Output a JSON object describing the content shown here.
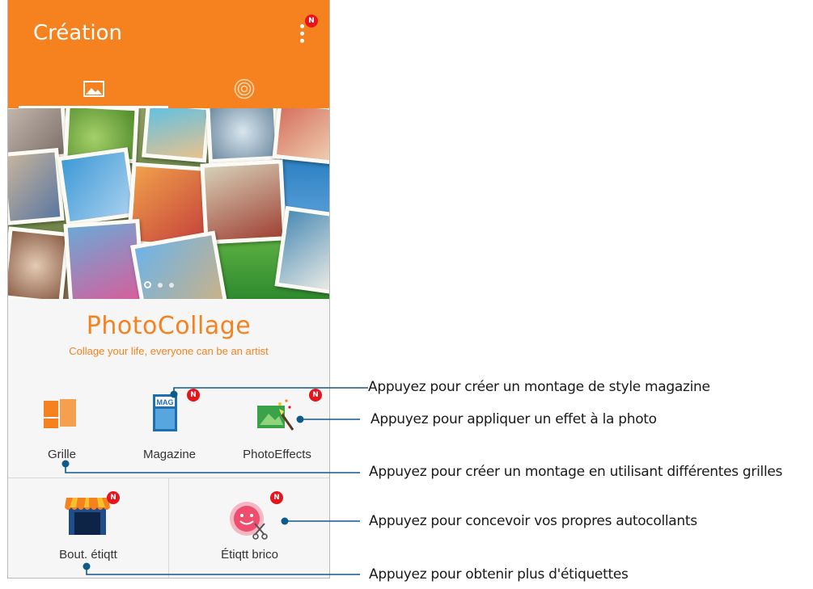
{
  "app": {
    "title": "Création",
    "menu_badge": "N",
    "tabs": [
      {
        "icon": "image-icon",
        "selected": true
      },
      {
        "icon": "live-target-icon",
        "selected": false
      }
    ],
    "colors": {
      "accent": "#f5821f",
      "badge": "#e8141c",
      "callout_line": "#0e5a8a"
    }
  },
  "banner": {
    "page_indicator": {
      "pages": 3,
      "current": 1
    }
  },
  "logo": {
    "name": "PhotoCollage",
    "tagline": "Collage your life, everyone can be an artist"
  },
  "tools": [
    {
      "label": "Grille",
      "icon": "grid-icon"
    },
    {
      "label": "Magazine",
      "icon": "magazine-icon",
      "badge": "N",
      "icon_text": "MAG"
    },
    {
      "label": "PhotoEffects",
      "icon": "photo-effects-icon",
      "badge": "N"
    }
  ],
  "bottom_tools": [
    {
      "label": "Bout. étiqtt",
      "icon": "shop-icon",
      "badge": "N"
    },
    {
      "label": "Étiqtt brico",
      "icon": "sticker-diy-icon",
      "badge": "N"
    }
  ],
  "callouts": [
    "Appuyez pour créer un montage de style magazine",
    "Appuyez pour appliquer un effet à la photo",
    "Appuyez pour créer un montage en utilisant différentes grilles",
    "Appuyez pour concevoir vos propres autocollants",
    "Appuyez pour obtenir plus d'étiquettes"
  ]
}
